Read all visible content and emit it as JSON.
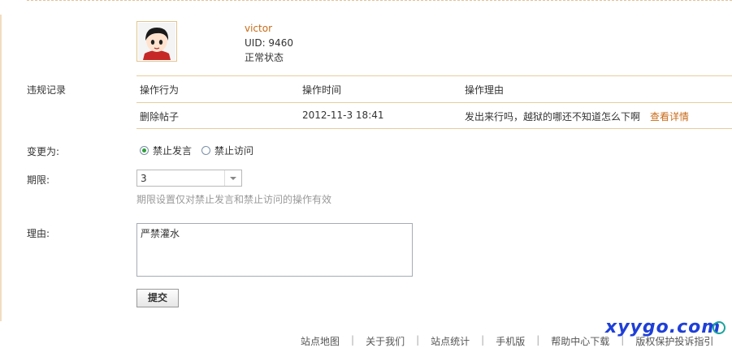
{
  "user": {
    "username": "victor",
    "uid": "UID: 9460",
    "status": "正常状态"
  },
  "labels": {
    "record": "违规记录",
    "change_to": "变更为:",
    "term": "期限:",
    "reason": "理由:"
  },
  "table": {
    "headers": [
      "操作行为",
      "操作时间",
      "操作理由"
    ],
    "rows": [
      {
        "action": "删除帖子",
        "time": "2012-11-3 18:41",
        "reason": "发出来行吗，越狱的哪还不知道怎么下啊",
        "link": "查看详情"
      }
    ]
  },
  "radios": {
    "options": [
      "禁止发言",
      "禁止访问"
    ],
    "selected": "禁止发言"
  },
  "term_select": {
    "value": "3"
  },
  "hint": "期限设置仅对禁止发言和禁止访问的操作有效",
  "reason_text": "严禁灌水",
  "submit_label": "提交",
  "footer_links": [
    "站点地图",
    "关于我们",
    "站点统计",
    "手机版",
    "帮助中心下载",
    "版权保护投诉指引"
  ],
  "watermark": "xyygo.com",
  "colors": {
    "accent": "#c86b18",
    "border": "#e6cc9e",
    "watermark": "#1e3fd8"
  }
}
